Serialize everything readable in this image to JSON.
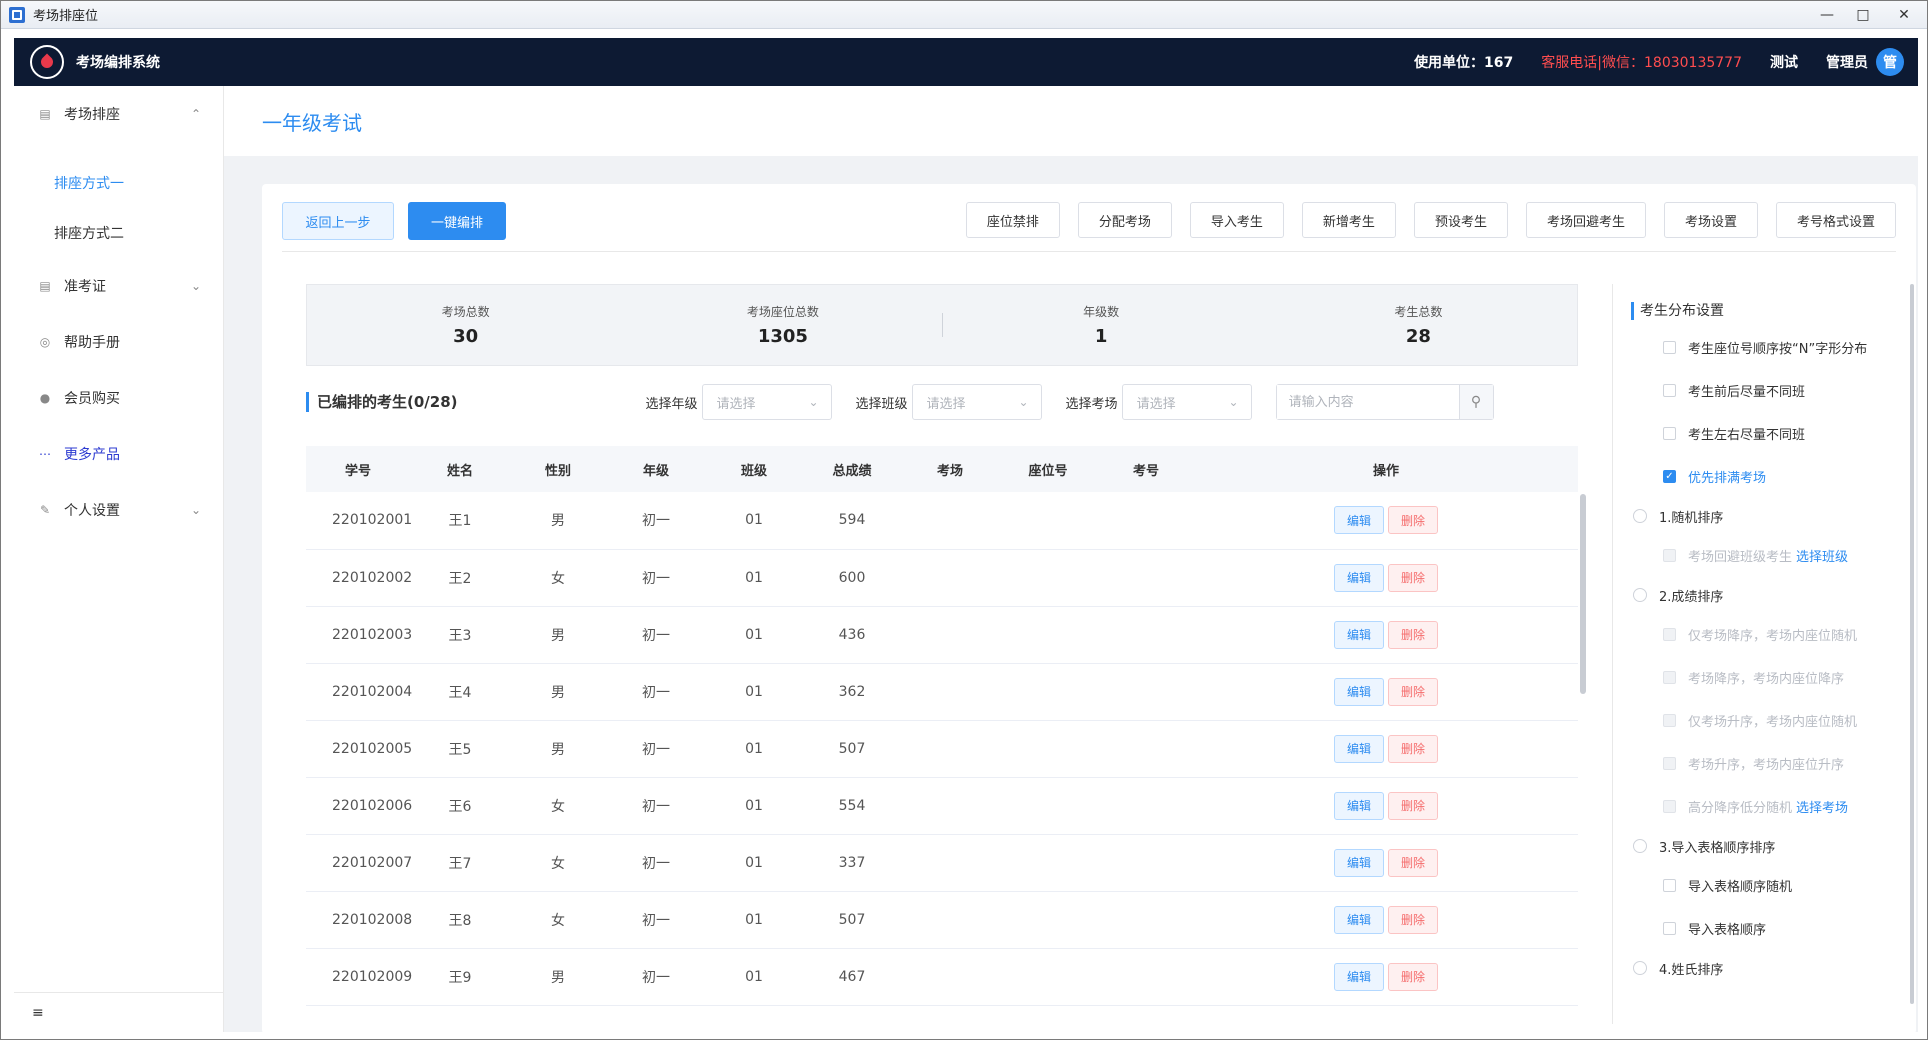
{
  "window": {
    "title": "考场排座位"
  },
  "app": {
    "name": "考场编排系统",
    "units_label": "使用单位：167",
    "hotline": "客服电话|微信：18030135777",
    "test_label": "测试",
    "role": "管理员",
    "avatar_text": "管"
  },
  "sidebar": {
    "groups": [
      {
        "label": "考场排座",
        "icon": "document-icon"
      },
      {
        "label": "准考证",
        "icon": "document-icon"
      },
      {
        "label": "帮助手册",
        "icon": "help-icon"
      },
      {
        "label": "会员购买",
        "icon": "user-icon"
      },
      {
        "label": "更多产品",
        "icon": "more-icon"
      },
      {
        "label": "个人设置",
        "icon": "edit-icon"
      }
    ],
    "sub": [
      "排座方式一",
      "排座方式二"
    ],
    "footer_icon": "≡"
  },
  "page": {
    "title": "一年级考试"
  },
  "toolbar": {
    "back": "返回上一步",
    "auto": "一键编排",
    "buttons": [
      "座位禁排",
      "分配考场",
      "导入考生",
      "新增考生",
      "预设考生",
      "考场回避考生",
      "考场设置",
      "考号格式设置"
    ]
  },
  "stats": [
    {
      "label": "考场总数",
      "value": "30"
    },
    {
      "label": "考场座位总数",
      "value": "1305"
    },
    {
      "label": "年级数",
      "value": "1"
    },
    {
      "label": "考生总数",
      "value": "28"
    }
  ],
  "filters": {
    "section_title": "已编排的考生(0/28)",
    "grade_label": "选择年级",
    "class_label": "选择班级",
    "room_label": "选择考场",
    "placeholder": "请选择",
    "search_placeholder": "请输入内容"
  },
  "table": {
    "headers": [
      "学号",
      "姓名",
      "性别",
      "年级",
      "班级",
      "总成绩",
      "考场",
      "座位号",
      "考号",
      "操作"
    ],
    "edit": "编辑",
    "delete": "删除",
    "rows": [
      [
        "220102001",
        "王1",
        "男",
        "初一",
        "01",
        "594"
      ],
      [
        "220102002",
        "王2",
        "女",
        "初一",
        "01",
        "600"
      ],
      [
        "220102003",
        "王3",
        "男",
        "初一",
        "01",
        "436"
      ],
      [
        "220102004",
        "王4",
        "男",
        "初一",
        "01",
        "362"
      ],
      [
        "220102005",
        "王5",
        "男",
        "初一",
        "01",
        "507"
      ],
      [
        "220102006",
        "王6",
        "女",
        "初一",
        "01",
        "554"
      ],
      [
        "220102007",
        "王7",
        "女",
        "初一",
        "01",
        "337"
      ],
      [
        "220102008",
        "王8",
        "女",
        "初一",
        "01",
        "507"
      ],
      [
        "220102009",
        "王9",
        "男",
        "初一",
        "01",
        "467"
      ]
    ]
  },
  "panel": {
    "title": "考生分布设置",
    "options": [
      {
        "type": "cb",
        "label": "考生座位号顺序按“N”字形分布",
        "checked": false,
        "disabled": false
      },
      {
        "type": "cb",
        "label": "考生前后尽量不同班",
        "checked": false,
        "disabled": false
      },
      {
        "type": "cb",
        "label": "考生左右尽量不同班",
        "checked": false,
        "disabled": false
      },
      {
        "type": "cb",
        "label": "优先排满考场",
        "checked": true,
        "disabled": false
      },
      {
        "type": "radio",
        "label": "1.随机排序"
      },
      {
        "type": "cb",
        "label": "考场回避班级考生",
        "link": "选择班级",
        "checked": false,
        "disabled": true
      },
      {
        "type": "radio",
        "label": "2.成绩排序"
      },
      {
        "type": "cb",
        "label": "仅考场降序，考场内座位随机",
        "checked": false,
        "disabled": true
      },
      {
        "type": "cb",
        "label": "考场降序，考场内座位降序",
        "checked": false,
        "disabled": true
      },
      {
        "type": "cb",
        "label": "仅考场升序，考场内座位随机",
        "checked": false,
        "disabled": true
      },
      {
        "type": "cb",
        "label": "考场升序，考场内座位升序",
        "checked": false,
        "disabled": true
      },
      {
        "type": "cb",
        "label": "高分降序低分随机",
        "link": "选择考场",
        "checked": false,
        "disabled": true
      },
      {
        "type": "radio",
        "label": "3.导入表格顺序排序"
      },
      {
        "type": "cb",
        "label": "导入表格顺序随机",
        "checked": false,
        "disabled": false
      },
      {
        "type": "cb",
        "label": "导入表格顺序",
        "checked": false,
        "disabled": false
      },
      {
        "type": "radio",
        "label": "4.姓氏排序"
      }
    ]
  },
  "colors": {
    "accent": "#2d8cf0",
    "danger": "#f56c6c",
    "topbar": "#0d1a33"
  }
}
